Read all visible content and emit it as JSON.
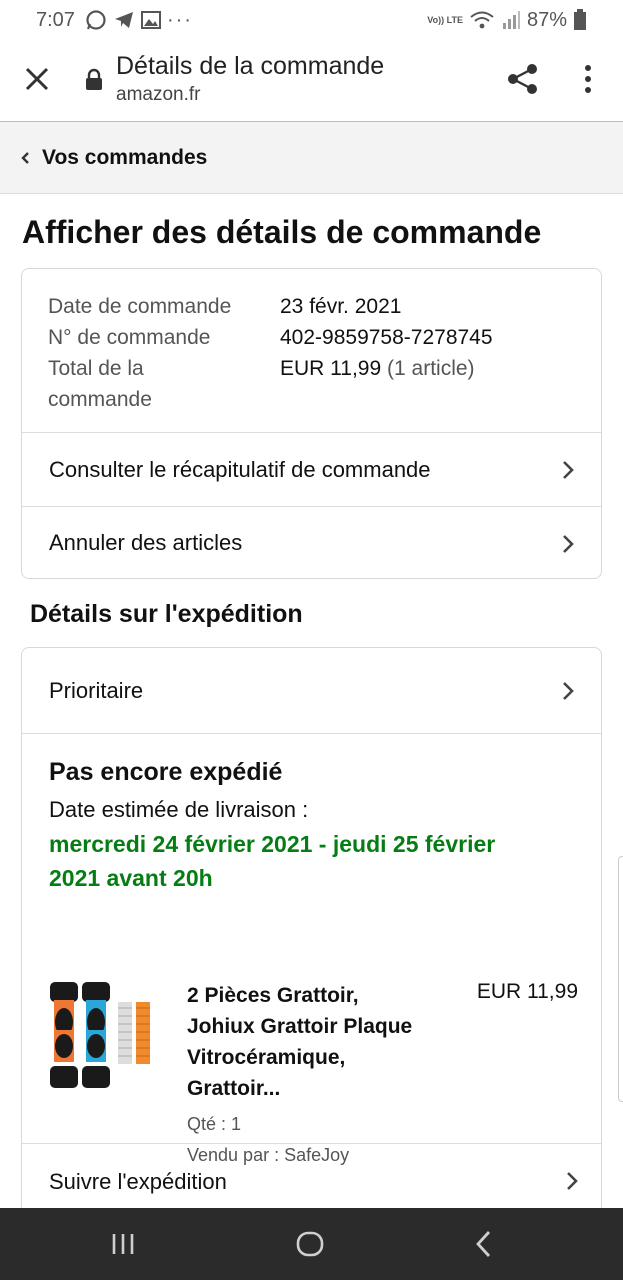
{
  "status_bar": {
    "time": "7:07",
    "volte": "Vo)) LTE",
    "battery": "87%"
  },
  "header": {
    "title": "Détails de la commande",
    "url": "amazon.fr"
  },
  "breadcrumb": {
    "label": "Vos commandes"
  },
  "page_title": "Afficher des détails de commande",
  "order_info": {
    "date_label": "Date de commande",
    "date_value": "23 févr. 2021",
    "number_label": "N° de commande",
    "number_value": "402-9859758-7278745",
    "total_label_1": "Total de la",
    "total_label_2": "commande",
    "total_value": "EUR 11,99",
    "total_items": "(1 article)"
  },
  "actions": {
    "summary": "Consulter le récapitulatif de commande",
    "cancel": "Annuler des articles"
  },
  "shipping": {
    "section_title": "Détails sur l'expédition",
    "speed": "Prioritaire",
    "status": "Pas encore expédié",
    "eta_label": "Date estimée de livraison :",
    "eta_line1": "mercredi 24 février 2021 - jeudi 25 février",
    "eta_line2": "2021 avant 20h",
    "track_label": "Suivre l'expédition"
  },
  "product": {
    "name_line1": "2 Pièces Grattoir,",
    "name_line2": "Johiux Grattoir Plaque",
    "name_line3": "Vitrocéramique,",
    "name_line4": "Grattoir...",
    "price": "EUR 11,99",
    "quantity": "Qté : 1",
    "seller": "Vendu par : SafeJoy"
  },
  "colors": {
    "eta_green": "#067d14",
    "nav_bar": "#2b2b2b",
    "breadcrumb_bg": "#f3f3f3"
  }
}
